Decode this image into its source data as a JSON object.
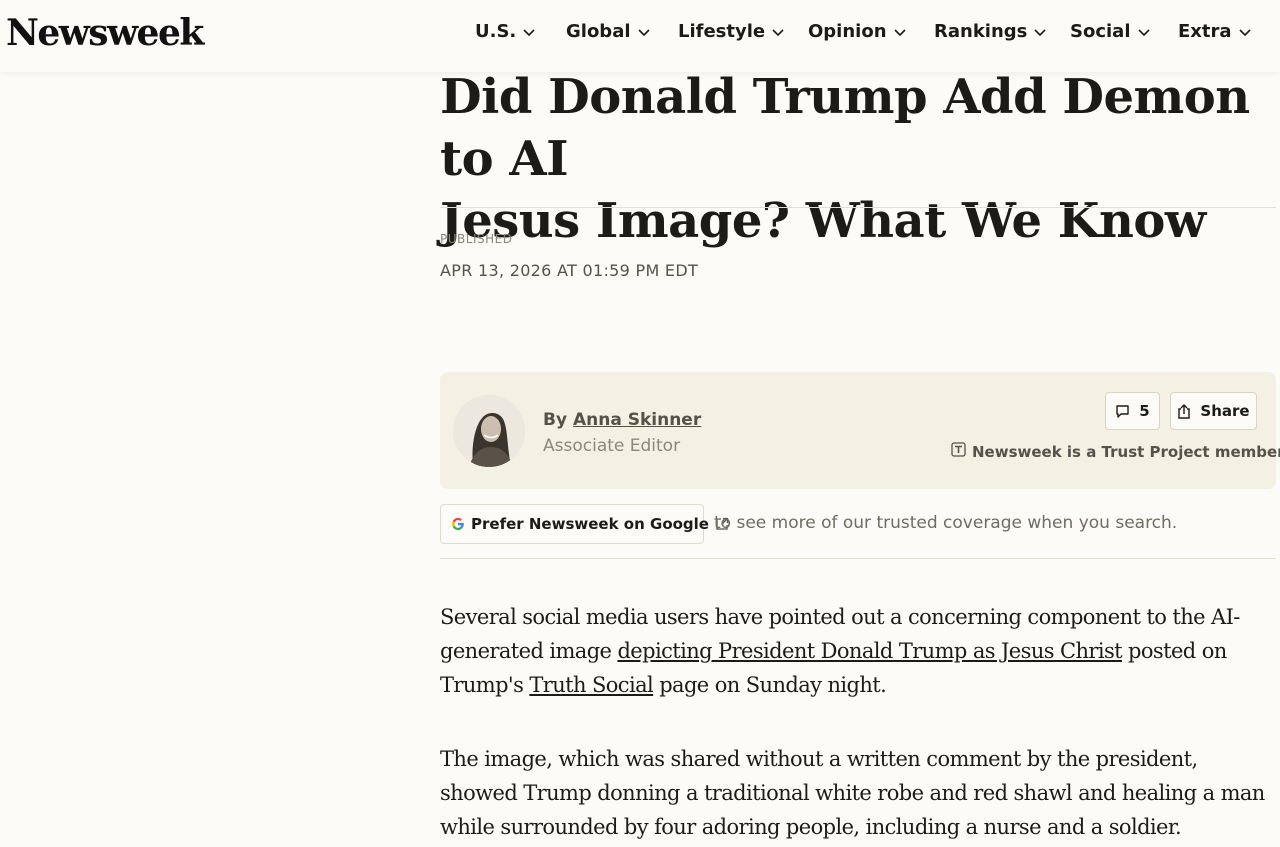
{
  "header": {
    "logo": "Newsweek",
    "nav": [
      {
        "label": "U.S."
      },
      {
        "label": "Global"
      },
      {
        "label": "Lifestyle"
      },
      {
        "label": "Opinion"
      },
      {
        "label": "Rankings"
      },
      {
        "label": "Social"
      },
      {
        "label": "Extra"
      }
    ]
  },
  "article": {
    "title_line1": "Did Donald Trump Add Demon to AI",
    "title_line2": "Jesus Image? What We Know",
    "published_label": "PUBLISHED",
    "published_date": "APR 13, 2026 AT 01:59 PM EDT",
    "author": {
      "by": "By",
      "name": "Anna Skinner",
      "role": "Associate Editor"
    },
    "comments_count": "5",
    "share_label": "Share",
    "trust_text": "Newsweek is a Trust Project member",
    "prefer_button": "Prefer Newsweek on Google",
    "prefer_text": "to see more of our trusted coverage when you search.",
    "p1_a": "Several social media users have pointed out a concerning component to the AI-generated image ",
    "p1_link1": "depicting President Donald Trump as Jesus Christ",
    "p1_b": " posted on Trump's ",
    "p1_link2": "Truth Social",
    "p1_c": " page on Sunday night.",
    "p2": "The image, which was shared without a written comment by the president, showed Trump donning a traditional white robe and red shawl and healing a man while surrounded by four adoring people, including a nurse and a soldier."
  },
  "icons": {
    "chevron": "chevron-down-icon",
    "comment": "comment-icon",
    "share": "share-icon",
    "trust": "trust-project-icon",
    "external": "external-link-icon",
    "google": "google-g-icon"
  }
}
